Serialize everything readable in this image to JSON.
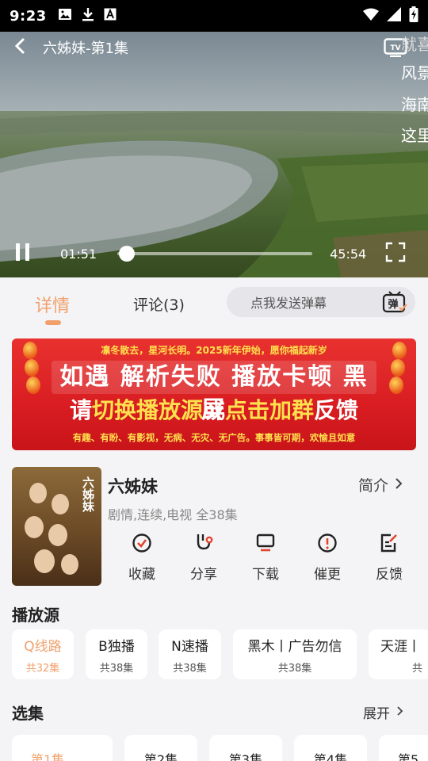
{
  "status_bar": {
    "time": "9:23",
    "icons": [
      "image-icon",
      "download-icon",
      "font-icon"
    ],
    "right_icons": [
      "wifi-icon",
      "signal-icon",
      "battery-charging-icon"
    ]
  },
  "player": {
    "title": "六姊妹-第1集",
    "current_time": "01:51",
    "total_time": "45:54",
    "progress": 0.04,
    "side_danmu": [
      "就喜",
      "风景",
      "海南",
      "这里"
    ]
  },
  "tabs": {
    "detail": "详情",
    "comment": "评论(3)",
    "danmu_placeholder": "点我发送弹幕",
    "danmu_icon_text": "弹"
  },
  "banner": {
    "top": "凛冬散去，星河长明。2025新年伊始，愿你福起新岁",
    "line1": "如遇 解析失败 播放卡顿 黑屏",
    "line2_a": "请",
    "line2_b": "切换播放源",
    "line2_c": "或",
    "line2_d": "点击加群",
    "line2_e": "反馈",
    "bottom": "有趣、有盼、有影视，无病、无灾、无广告。事事皆可期，欢愉且如意"
  },
  "show": {
    "title": "六姊妹",
    "poster_title": "六姊妹",
    "intro": "简介",
    "meta": "剧情,连续,电视 全38集",
    "actions": [
      {
        "label": "收藏",
        "icon": "collect-icon"
      },
      {
        "label": "分享",
        "icon": "share-icon"
      },
      {
        "label": "下载",
        "icon": "download-icon"
      },
      {
        "label": "催更",
        "icon": "urge-icon"
      },
      {
        "label": "反馈",
        "icon": "feedback-icon"
      }
    ]
  },
  "sources": {
    "title": "播放源",
    "items": [
      {
        "name": "Q线路",
        "count": "共32集"
      },
      {
        "name": "B独播",
        "count": "共38集"
      },
      {
        "name": "N速播",
        "count": "共38集"
      },
      {
        "name": "黑木丨广告勿信",
        "count": "共38集"
      },
      {
        "name": "天涯丨",
        "count": "共"
      }
    ]
  },
  "episodes": {
    "title": "选集",
    "expand": "展开",
    "items": [
      "第1集",
      "第2集",
      "第3集",
      "第4集",
      "第5"
    ]
  },
  "colors": {
    "accent": "#f1a06c",
    "banner_red": "#d91d22",
    "banner_yellow": "#ffe14d",
    "icon_red": "#e1452e"
  }
}
